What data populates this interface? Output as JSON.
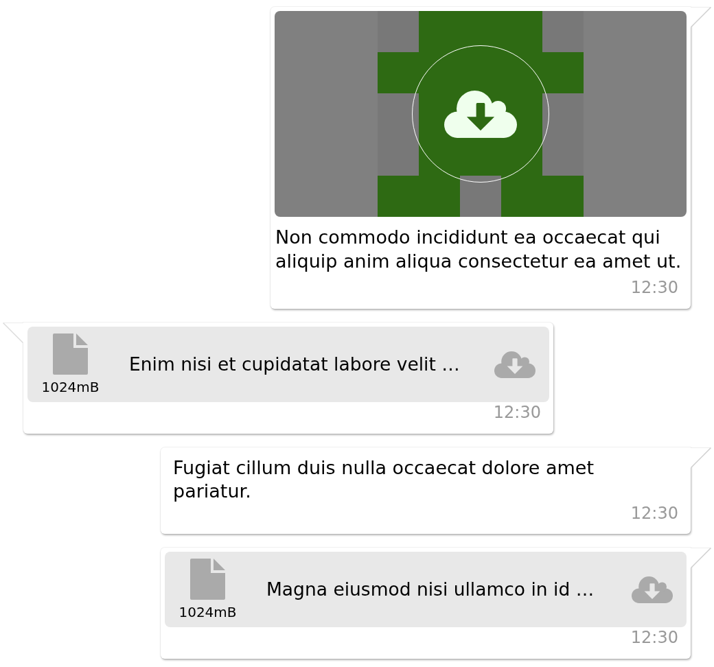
{
  "messages": [
    {
      "kind": "image",
      "outgoing": true,
      "caption": "Non commodo incididunt ea occaecat qui aliquip anim aliqua consectetur ea amet ut.",
      "time": "12:30"
    },
    {
      "kind": "file",
      "outgoing": false,
      "file_size": "1024mB",
      "file_name": "Enim nisi et cupidatat labore velit …",
      "time": "12:30"
    },
    {
      "kind": "text",
      "outgoing": true,
      "text": "Fugiat cillum duis nulla occaecat dolore amet pariatur.",
      "time": "12:30"
    },
    {
      "kind": "file",
      "outgoing": true,
      "file_size": "1024mB",
      "file_name": "Magna eiusmod nisi ullamco in id …",
      "time": "12:30"
    }
  ]
}
